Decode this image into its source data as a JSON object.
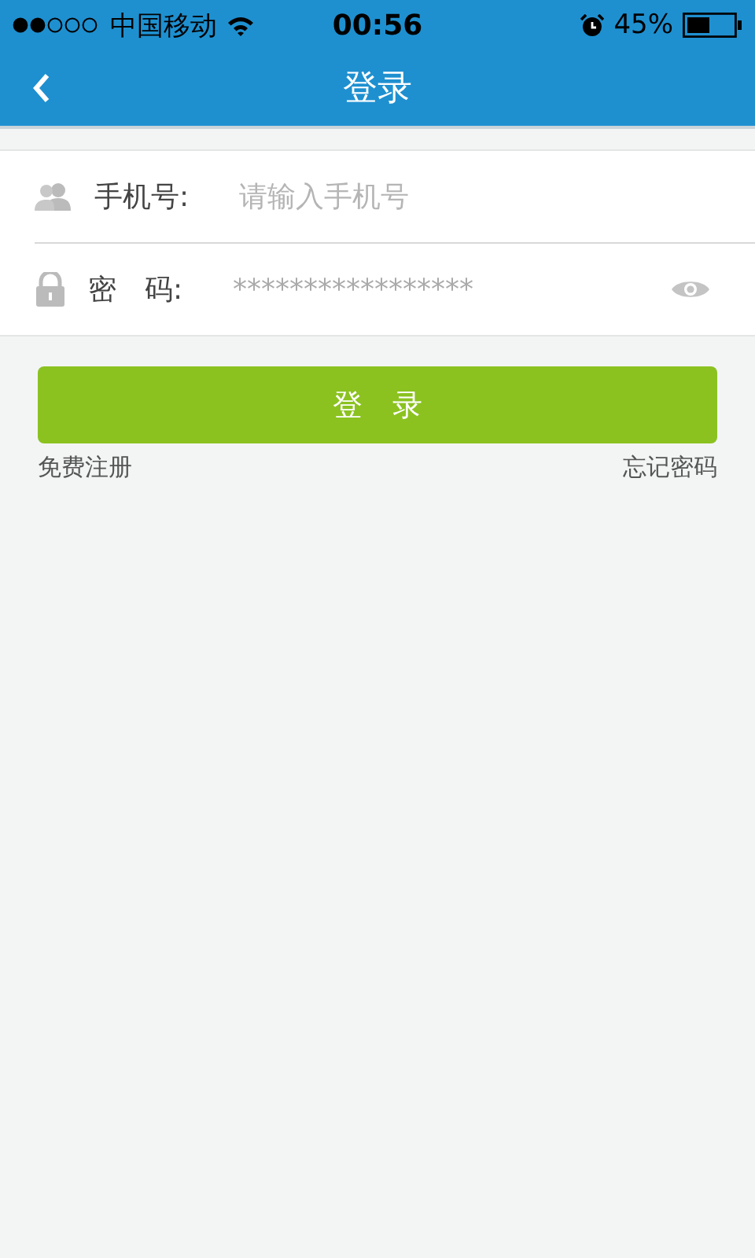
{
  "status_bar": {
    "carrier": "中国移动",
    "time": "00:56",
    "battery": "45%"
  },
  "nav": {
    "title": "登录"
  },
  "form": {
    "fields": [
      {
        "kind": "phone",
        "label": "手机号:",
        "placeholder": "请输入手机号"
      },
      {
        "kind": "password",
        "label": "密　码:",
        "value": "*****************"
      }
    ]
  },
  "login_button": "登　录",
  "links": {
    "register": "免费注册",
    "forgot": "忘记密码"
  }
}
